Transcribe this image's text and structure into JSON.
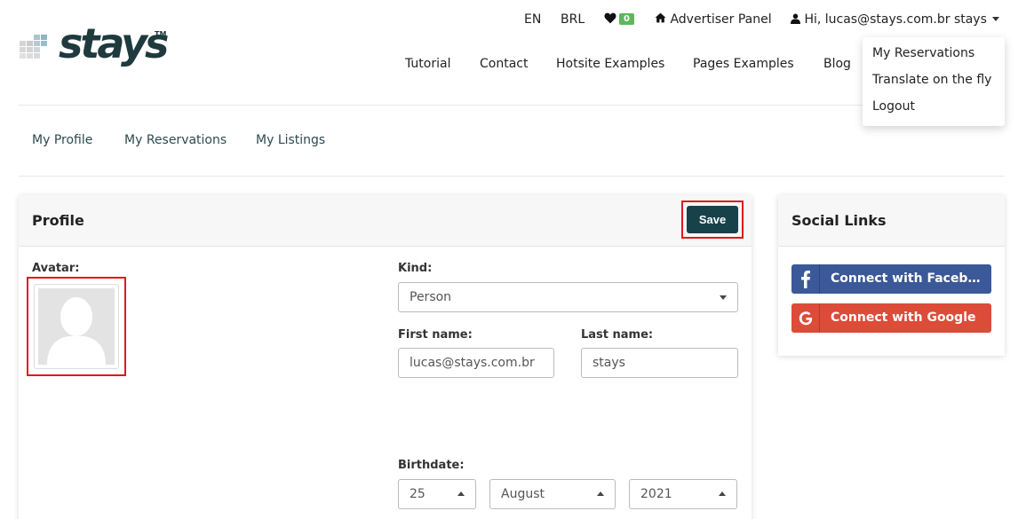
{
  "brand": {
    "name": "stays",
    "trademark": "TM"
  },
  "topbar": {
    "lang": "EN",
    "currency": "BRL",
    "favorites_count": "0",
    "advertiser_panel": "Advertiser Panel",
    "user_greeting": "Hi, lucas@stays.com.br stays"
  },
  "nav": [
    "Tutorial",
    "Contact",
    "Hotsite Examples",
    "Pages Examples",
    "Blog"
  ],
  "user_menu": [
    "My Reservations",
    "Translate on the fly",
    "Logout"
  ],
  "tabs": [
    "My Profile",
    "My Reservations",
    "My Listings"
  ],
  "profile": {
    "title": "Profile",
    "save_label": "Save",
    "avatar_label": "Avatar:",
    "kind_label": "Kind:",
    "kind_value": "Person",
    "first_name_label": "First name:",
    "first_name_value": "lucas@stays.com.br",
    "last_name_label": "Last name:",
    "last_name_value": "stays",
    "birthdate_label": "Birthdate:",
    "birth_day": "25",
    "birth_month": "August",
    "birth_year": "2021"
  },
  "social": {
    "title": "Social Links",
    "facebook_label": "Connect with Facebook",
    "google_label": "Connect with Google"
  },
  "colors": {
    "brand_dark": "#17424a",
    "facebook": "#3b5998",
    "google": "#dd4b39",
    "favorites_badge": "#5cb85c",
    "highlight": "#e0181c"
  }
}
